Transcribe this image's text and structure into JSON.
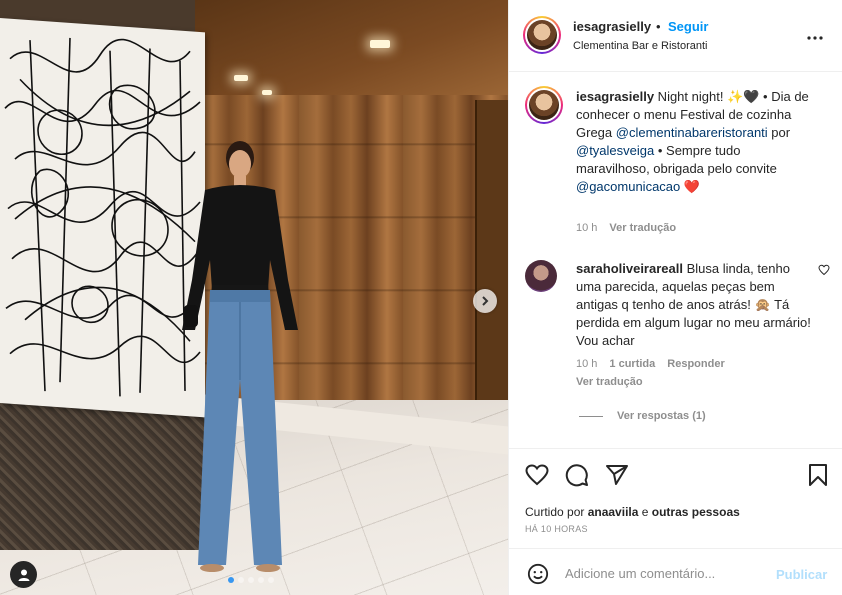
{
  "post": {
    "username": "iesagrasielly",
    "follow_label": "Seguir",
    "separator": "•",
    "location": "Clementina Bar e Ristoranti",
    "more_label": "•••"
  },
  "caption": {
    "username": "iesagrasielly",
    "text_1": " Night night! ✨🖤 • Dia de conhecer o menu Festival de cozinha Grega ",
    "mention_1": "@clementinabareristoranti",
    "text_2": " por ",
    "mention_2": "@tyalesveiga",
    "text_3": " • Sempre tudo maravilhoso, obrigada pelo convite ",
    "mention_3": "@gacomunicacao",
    "text_4": " ❤️",
    "time": "10 h",
    "translate": "Ver tradução"
  },
  "comment": {
    "username": "saraholiveirareall",
    "text": " Blusa linda, tenho uma parecida, aquelas peças bem antigas q tenho de anos atrás! 🙊 Tá perdida em algum lugar no meu armário! Vou achar",
    "time": "10 h",
    "likes": "1 curtida",
    "reply": "Responder",
    "translate": "Ver tradução",
    "view_replies": "Ver respostas (1)"
  },
  "engagement": {
    "liked_prefix": "Curtido por ",
    "liked_user": "anaaviila",
    "liked_middle": " e ",
    "liked_others": "outras pessoas",
    "time_ago": "HÁ 10 HORAS"
  },
  "composer": {
    "placeholder": "Adicione um comentário...",
    "publish_label": "Publicar"
  },
  "carousel": {
    "next_label": "›",
    "slide_count": 5,
    "active_slide": 1
  },
  "colors": {
    "link_blue": "#0095f6",
    "mention": "#00376b",
    "muted": "#8e8e8e",
    "publish_disabled": "#b2dffc",
    "like_red": "#ed4956"
  },
  "icons": [
    "heart-icon",
    "comment-icon",
    "share-icon",
    "save-icon",
    "emoji-icon",
    "user-tag-icon",
    "more-icon",
    "chevron-right-icon"
  ]
}
